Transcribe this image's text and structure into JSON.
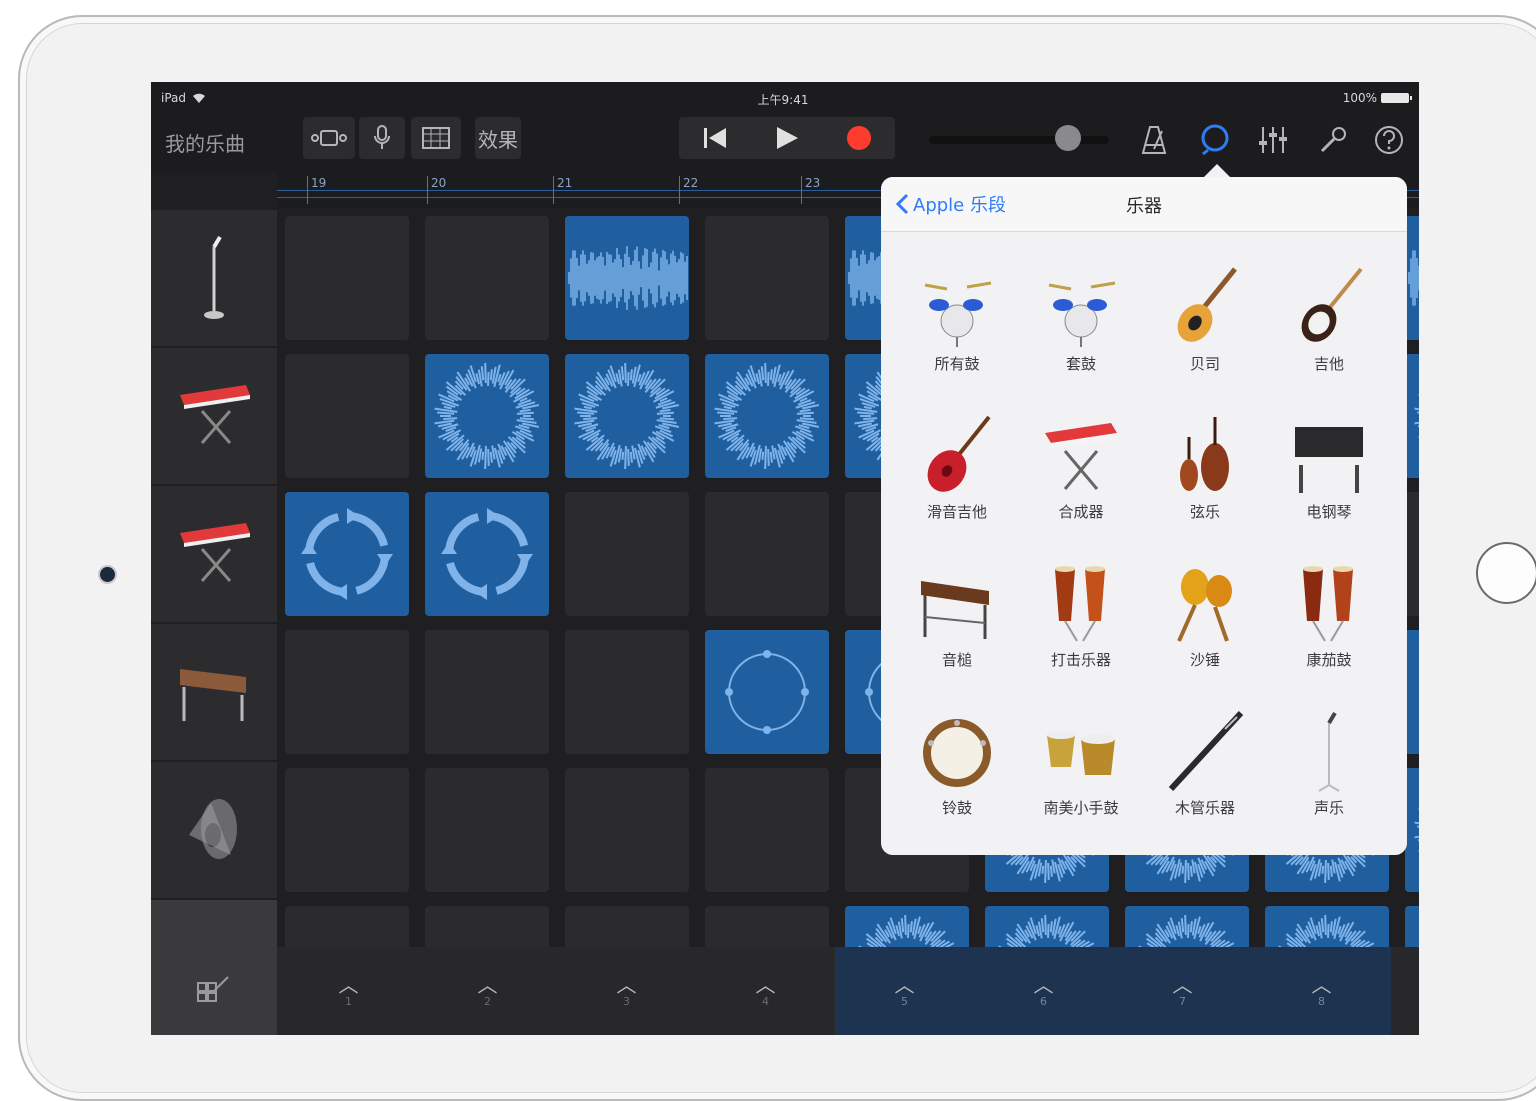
{
  "status": {
    "device": "iPad",
    "time": "上午9:41",
    "battery": "100%"
  },
  "toolbar": {
    "title": "我的乐曲",
    "effects_label": "效果"
  },
  "ruler": [
    "19",
    "20",
    "21",
    "22",
    "23"
  ],
  "triggers": [
    "1",
    "2",
    "3",
    "4",
    "5",
    "6",
    "7",
    "8"
  ],
  "popover": {
    "back_label": "Apple 乐段",
    "title": "乐器",
    "instruments": [
      {
        "label": "所有鼓",
        "icon": "drum-kit-icon"
      },
      {
        "label": "套鼓",
        "icon": "drum-kit-icon"
      },
      {
        "label": "贝司",
        "icon": "bass-guitar-icon"
      },
      {
        "label": "吉他",
        "icon": "electric-guitar-icon"
      },
      {
        "label": "滑音吉他",
        "icon": "hollow-guitar-icon"
      },
      {
        "label": "合成器",
        "icon": "synth-keyboard-icon"
      },
      {
        "label": "弦乐",
        "icon": "strings-icon"
      },
      {
        "label": "电钢琴",
        "icon": "electric-piano-icon"
      },
      {
        "label": "音槌",
        "icon": "mallet-icon"
      },
      {
        "label": "打击乐器",
        "icon": "percussion-icon"
      },
      {
        "label": "沙锤",
        "icon": "maracas-icon"
      },
      {
        "label": "康茄鼓",
        "icon": "conga-icon"
      },
      {
        "label": "铃鼓",
        "icon": "tambourine-icon"
      },
      {
        "label": "南美小手鼓",
        "icon": "bongo-icon"
      },
      {
        "label": "木管乐器",
        "icon": "woodwind-icon"
      },
      {
        "label": "声乐",
        "icon": "microphone-icon"
      }
    ]
  },
  "colors": {
    "accent": "#2f7cf6",
    "cell_blue": "#1f5fa0",
    "record": "#ff3b30"
  }
}
